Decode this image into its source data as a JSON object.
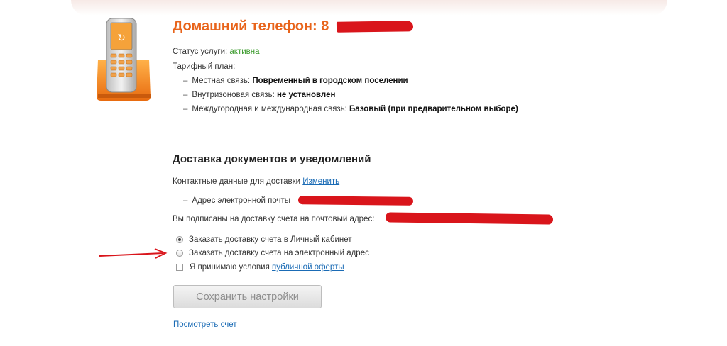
{
  "header": {
    "title": "Домашний телефон: 8"
  },
  "service": {
    "status_label": "Статус услуги:",
    "status_value": "активна",
    "tariff_label": "Тарифный план:",
    "tariff_items": [
      {
        "label": "Местная связь:",
        "value": "Повременный в городском поселении"
      },
      {
        "label": "Внутризоновая связь:",
        "value": "не установлен"
      },
      {
        "label": "Междугородная и международная связь:",
        "value": "Базовый (при предварительном выборе)"
      }
    ]
  },
  "delivery": {
    "section_title": "Доставка документов и уведомлений",
    "contacts_label": "Контактные данные для доставки",
    "change_link": "Изменить",
    "email_label": "Адрес электронной почты",
    "subscribed_label": "Вы подписаны на доставку счета на почтовый адрес:",
    "options": [
      {
        "label": "Заказать доставку счета в Личный кабинет",
        "checked": true
      },
      {
        "label": "Заказать доставку счета на электронный адрес",
        "checked": false
      }
    ],
    "accept_prefix": "Я принимаю условия",
    "accept_link": "публичной оферты",
    "save_button": "Сохранить настройки",
    "view_bill_link": "Посмотреть счет"
  },
  "colors": {
    "title": "#e8641b",
    "status_active": "#3a9a2b",
    "link": "#1a6bb5",
    "redaction": "#d9151b",
    "arrow": "#d9151b"
  }
}
